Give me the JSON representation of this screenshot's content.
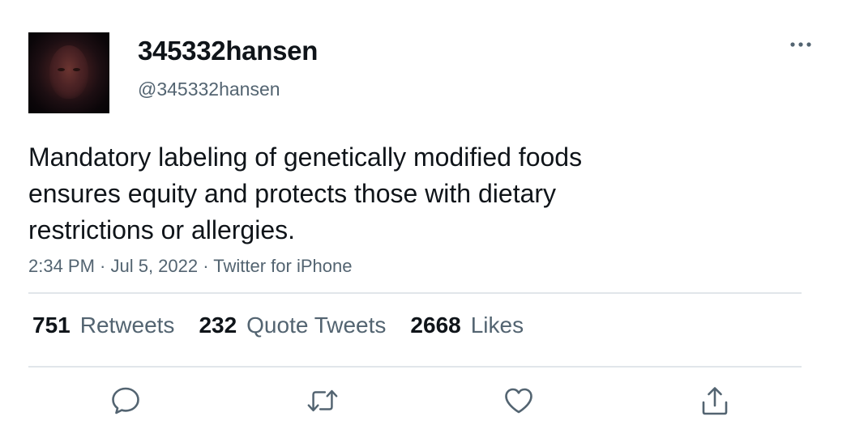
{
  "user": {
    "display_name": "345332hansen",
    "handle": "@345332hansen"
  },
  "tweet": {
    "lines": [
      "Mandatory labeling of genetically modified foods",
      "ensures equity and protects those with dietary",
      "restrictions or allergies."
    ],
    "meta": "2:34 PM · Jul 5, 2022 · Twitter for iPhone"
  },
  "stats": {
    "retweets_count": "751",
    "retweets_label": "Retweets",
    "quotes_count": "232",
    "quotes_label": "Quote Tweets",
    "likes_count": "2668",
    "likes_label": "Likes"
  },
  "icons": {
    "more": "more-icon",
    "reply": "reply-icon",
    "retweet": "retweet-icon",
    "like": "heart-icon",
    "share": "share-icon"
  },
  "colors": {
    "text": "#0f1419",
    "secondary": "#536471",
    "divider": "#e1e6ea"
  }
}
